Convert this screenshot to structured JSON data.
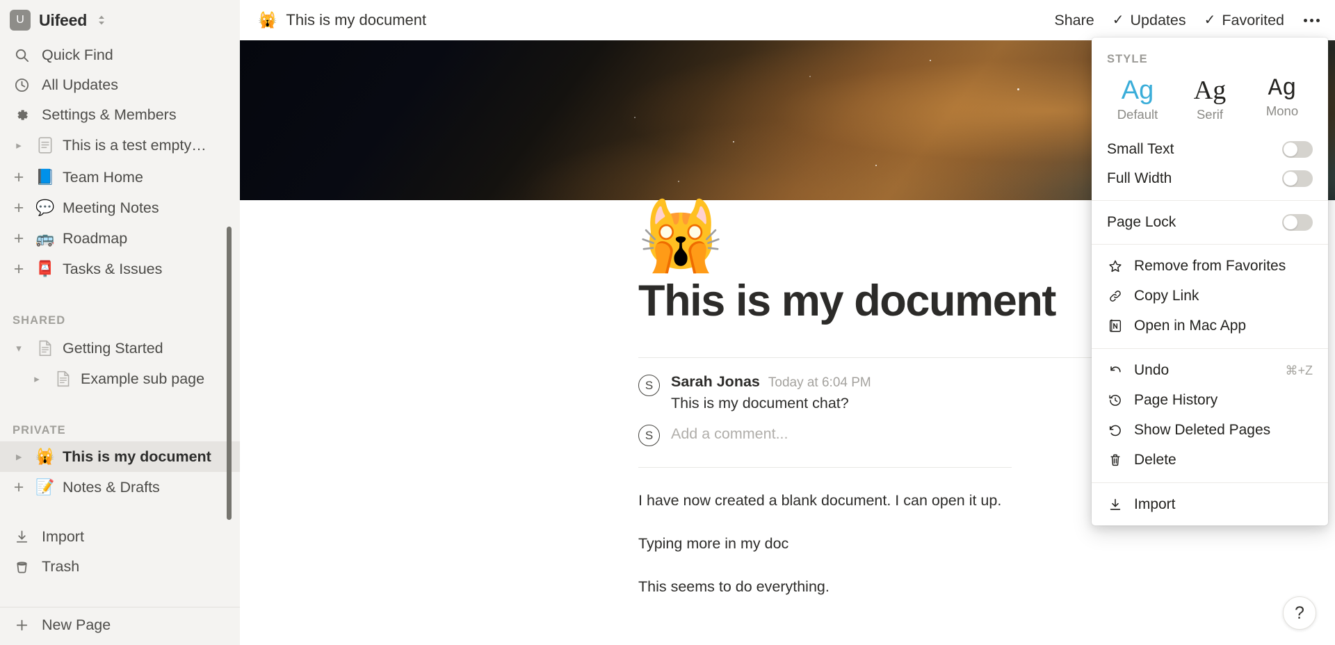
{
  "sidebar": {
    "workspace": {
      "initial": "U",
      "name": "Uifeed",
      "chevron": "⌃⌄"
    },
    "nav": [
      {
        "label": "Quick Find",
        "icon": "search-icon"
      },
      {
        "label": "All Updates",
        "icon": "clock-icon"
      },
      {
        "label": "Settings & Members",
        "icon": "gear-icon"
      }
    ],
    "clipped_item": {
      "label": "This is a test empty…",
      "icon": "page-icon",
      "twisty": "▸"
    },
    "workspace_pages": [
      {
        "label": "Team Home",
        "emoji": "📘",
        "twisty": "+",
        "shared": true
      },
      {
        "label": "Meeting Notes",
        "emoji": "💬",
        "twisty": "+",
        "shared": true
      },
      {
        "label": "Roadmap",
        "emoji": "🚌",
        "twisty": "+",
        "shared": true
      },
      {
        "label": "Tasks & Issues",
        "emoji": "📮",
        "twisty": "+",
        "shared": true
      }
    ],
    "shared_section": "SHARED",
    "shared_pages": [
      {
        "label": "Getting Started",
        "emoji": "page-icon",
        "twisty": "▾",
        "indent": 0
      },
      {
        "label": "Example sub page",
        "emoji": "page-icon",
        "twisty": "▸",
        "indent": 1
      }
    ],
    "private_section": "PRIVATE",
    "private_pages": [
      {
        "label": "This is my document",
        "emoji": "🙀",
        "twisty": "▸",
        "selected": true
      },
      {
        "label": "Notes & Drafts",
        "emoji": "📝",
        "twisty": "+",
        "shared": true
      }
    ],
    "footer": [
      {
        "label": "Import",
        "icon": "download-icon"
      },
      {
        "label": "Trash",
        "icon": "trash-icon"
      }
    ],
    "new_page": {
      "label": "New Page",
      "icon": "plus-icon"
    }
  },
  "topbar": {
    "doc_emoji": "🙀",
    "doc_title": "This is my document",
    "share_label": "Share",
    "updates_label": "Updates",
    "updates_check": "✓",
    "favorited_label": "Favorited",
    "favorited_check": "✓"
  },
  "document": {
    "title": "This is my document",
    "emoji": "🙀",
    "comment": {
      "avatar_initial": "S",
      "author": "Sarah Jonas",
      "time": "Today at 6:04 PM",
      "body": "This is my document chat?"
    },
    "add_comment": {
      "avatar_initial": "S",
      "placeholder": "Add a comment..."
    },
    "paragraphs": [
      "I have now created a blank document. I can open it up.",
      "Typing more in my doc",
      "This seems to do everything."
    ]
  },
  "menu": {
    "style_label": "STYLE",
    "styles": [
      {
        "sample": "Ag",
        "caption": "Default",
        "selected": true
      },
      {
        "sample": "Ag",
        "caption": "Serif",
        "selected": false
      },
      {
        "sample": "Ag",
        "caption": "Mono",
        "selected": false
      }
    ],
    "toggles": [
      {
        "label": "Small Text",
        "on": false
      },
      {
        "label": "Full Width",
        "on": false
      },
      {
        "label": "Page Lock",
        "on": false
      }
    ],
    "group_a": [
      {
        "label": "Remove from Favorites",
        "icon": "star-icon"
      },
      {
        "label": "Copy Link",
        "icon": "link-icon"
      },
      {
        "label": "Open in Mac App",
        "icon": "notion-app-icon"
      }
    ],
    "group_b": [
      {
        "label": "Undo",
        "icon": "undo-icon",
        "shortcut": "⌘+Z"
      },
      {
        "label": "Page History",
        "icon": "history-icon",
        "shortcut": ""
      },
      {
        "label": "Show Deleted Pages",
        "icon": "restore-icon",
        "shortcut": ""
      },
      {
        "label": "Delete",
        "icon": "trash-icon",
        "shortcut": ""
      }
    ],
    "group_c": [
      {
        "label": "Import",
        "icon": "download-icon"
      }
    ]
  },
  "help_button": {
    "label": "?"
  },
  "colors": {
    "sidebar_bg": "#f4f3f1",
    "accent_blue": "#3aadd9",
    "text_primary": "#2d2c2a",
    "text_muted": "#a4a29e",
    "selected_row": "#e6e4e1"
  }
}
